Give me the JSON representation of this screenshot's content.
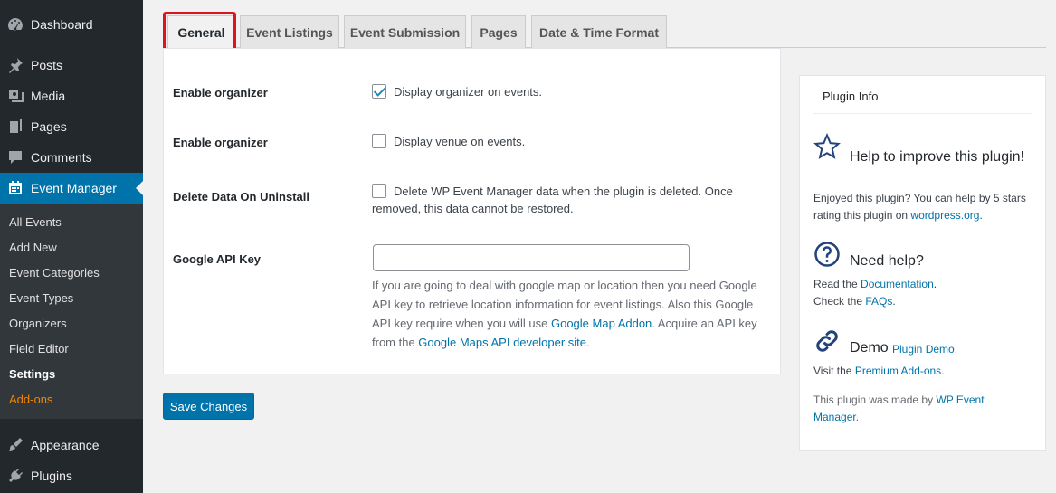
{
  "sidebar": {
    "menu": [
      {
        "label": "Dashboard",
        "icon": "dashboard-icon"
      },
      {
        "label": "Posts",
        "icon": "pin-icon"
      },
      {
        "label": "Media",
        "icon": "media-icon"
      },
      {
        "label": "Pages",
        "icon": "pages-icon"
      },
      {
        "label": "Comments",
        "icon": "comment-icon"
      },
      {
        "label": "Event Manager",
        "icon": "calendar-icon"
      },
      {
        "label": "Appearance",
        "icon": "brush-icon"
      },
      {
        "label": "Plugins",
        "icon": "plugin-icon"
      }
    ],
    "submenu": [
      "All Events",
      "Add New",
      "Event Categories",
      "Event Types",
      "Organizers",
      "Field Editor",
      "Settings",
      "Add-ons"
    ],
    "active_color": "#0073aa",
    "addons_color": "#f18500"
  },
  "tabs": [
    "General",
    "Event Listings",
    "Event Submission",
    "Pages",
    "Date & Time Format"
  ],
  "settings": {
    "rows": [
      {
        "label": "Enable organizer",
        "option": "Display organizer on events.",
        "checked": true
      },
      {
        "label": "Enable organizer",
        "option": "Display venue on events.",
        "checked": false
      },
      {
        "label": "Delete Data On Uninstall",
        "option": "Delete WP Event Manager data when the plugin is deleted. Once removed, this data cannot be restored.",
        "checked": false
      }
    ],
    "api_key": {
      "label": "Google API Key",
      "value": "",
      "desc_1": "If you are going to deal with google map or location then you need Google API key to retrieve location information for event listings. Also this Google API key require when you will use ",
      "link_1": "Google Map Addon",
      "desc_2": ". Acquire an API key from the ",
      "link_2": "Google Maps API developer site",
      "desc_3": "."
    },
    "save_label": "Save Changes"
  },
  "plugin_info": {
    "title": "Plugin Info",
    "improve_heading": "Help to improve this plugin!",
    "improve_text": "Enjoyed this plugin? You can help by 5 stars rating this plugin on ",
    "improve_link": "wordpress.org",
    "improve_end": ".",
    "help_heading": "Need help?",
    "help_read": "Read the ",
    "help_doc_link": "Documentation",
    "help_check": "Check the ",
    "help_faq_link": "FAQs",
    "demo_heading": "Demo",
    "demo_link": "Plugin Demo.",
    "visit_text": "Visit the ",
    "premium_link": "Premium Add-ons",
    "made_by": "This plugin was made by ",
    "made_by_link": "WP Event Manager",
    "dot": "."
  },
  "highlight_color": "#e0121e"
}
